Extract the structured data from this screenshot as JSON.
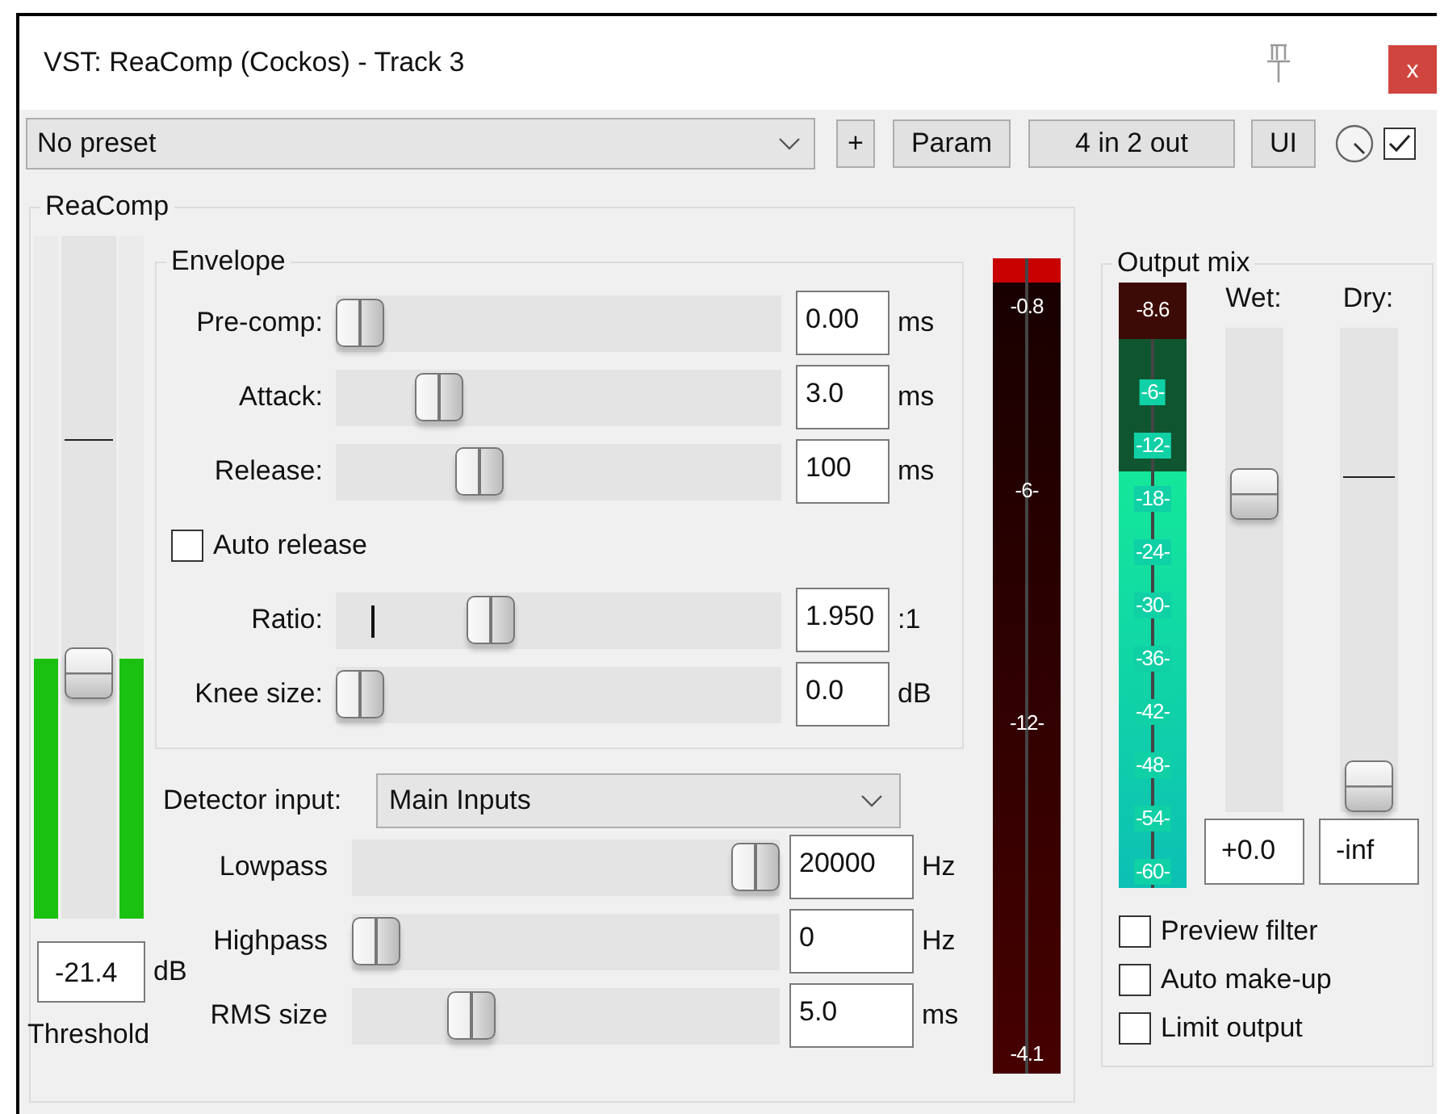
{
  "window": {
    "title": "VST: ReaComp (Cockos) - Track 3",
    "close": "x"
  },
  "toolbar": {
    "preset": "No preset",
    "buttons": [
      "+",
      "Param",
      "4 in 2 out",
      "UI"
    ],
    "enabled": true
  },
  "plugin": {
    "title": "ReaComp",
    "threshold": {
      "level": 0.35,
      "meter": {
        "level": 0.38
      },
      "marker": {
        "level": 0.7
      },
      "value": "-21.4",
      "unit": "dB",
      "label": "Threshold"
    },
    "envelope": {
      "title": "Envelope",
      "rows": [
        {
          "kind": "slider",
          "label": "Pre-comp:",
          "level": 0,
          "value": "0.00",
          "unit": "ms"
        },
        {
          "kind": "slider",
          "label": "Attack:",
          "level": 0.2,
          "value": "3.0",
          "unit": "ms"
        },
        {
          "kind": "slider",
          "label": "Release:",
          "level": 0.3,
          "value": "100",
          "unit": "ms"
        },
        {
          "kind": "checkbox",
          "label": "Auto release",
          "checked": false
        },
        {
          "kind": "slider",
          "label": "Ratio:",
          "level": 0.33,
          "marker": {
            "level": 0.08
          },
          "value": "1.950",
          "unit": ":1"
        },
        {
          "kind": "slider",
          "label": "Knee size:",
          "level": 0,
          "value": "0.0",
          "unit": "dB"
        }
      ]
    },
    "detector": {
      "label": "Detector input:",
      "value": "Main Inputs"
    },
    "filters": [
      {
        "label": "Lowpass",
        "level": 1,
        "value": "20000",
        "unit": "Hz"
      },
      {
        "label": "Highpass",
        "level": 0,
        "value": "0",
        "unit": "Hz"
      },
      {
        "label": "RMS size",
        "level": 0.25,
        "value": "5.0",
        "unit": "ms"
      }
    ],
    "gain_reduction_meter": {
      "level": 0.03,
      "peak": "-0.8",
      "scale": [
        "-6-",
        "-12-"
      ],
      "reading": "-4.1"
    }
  },
  "output_mix": {
    "title": "Output mix",
    "meter": {
      "level": 0.76,
      "peak": "-8.6",
      "scale": [
        "-6-",
        "-12-",
        "-18-",
        "-24-",
        "-30-",
        "-36-",
        "-42-",
        "-48-",
        "-54-",
        "-60-"
      ]
    },
    "faders": [
      {
        "label": "Wet:",
        "level": 0.68,
        "value": "+0.0"
      },
      {
        "label": "Dry:",
        "level": 0,
        "marker": {
          "level": 0.69
        },
        "value": "-inf"
      }
    ],
    "options": [
      {
        "label": "Preview filter",
        "checked": false
      },
      {
        "label": "Auto make-up",
        "checked": false
      },
      {
        "label": "Limit output",
        "checked": false
      }
    ]
  }
}
